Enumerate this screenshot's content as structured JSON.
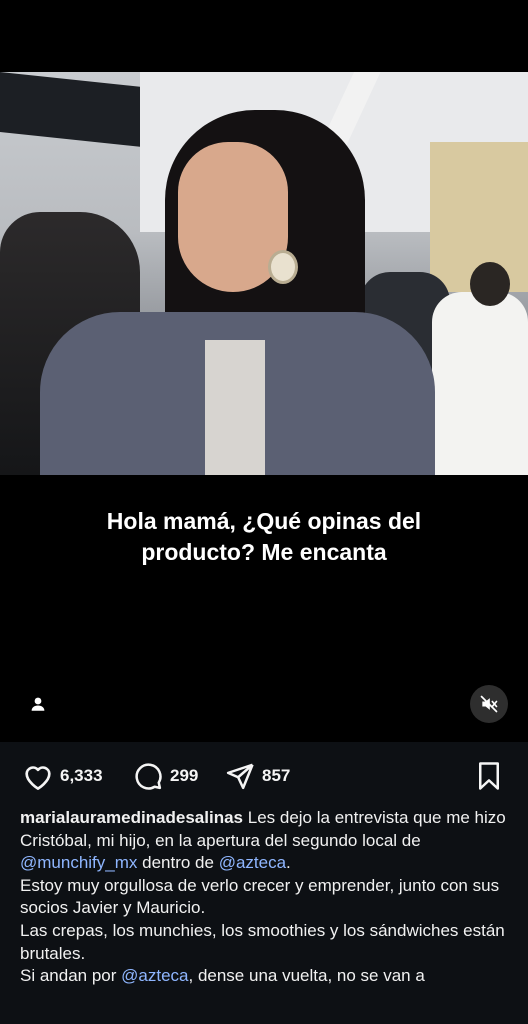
{
  "video": {
    "caption_line1": "Hola mamá, ¿Qué opinas del",
    "caption_line2": "producto? Me encanta"
  },
  "actions": {
    "likes": "6,333",
    "comments": "299",
    "shares": "857"
  },
  "post": {
    "username": "marialauramedinadesalinas",
    "text1": " Les dejo la entrevista que me hizo Cristóbal, mi hijo, en la apertura del segundo local de ",
    "mention1": "@munchify_mx",
    "text2": " dentro de ",
    "mention2": "@azteca",
    "text3": ".",
    "para2": "Estoy muy orgullosa de verlo crecer y emprender, junto con sus socios Javier y Mauricio.",
    "para3": "Las crepas, los munchies, los smoothies y los sándwiches están brutales.",
    "para4_a": "Si andan por ",
    "mention3": "@azteca",
    "para4_b": ", dense una vuelta, no se van a"
  },
  "icons": {
    "like": "heart-icon",
    "comment": "comment-bubble-icon",
    "share": "paper-plane-icon",
    "save": "bookmark-icon",
    "user_tag": "person-icon",
    "mute": "speaker-muted-icon"
  },
  "colors": {
    "background": "#000000",
    "post_background": "#0d1014",
    "mention": "#8fb6ff"
  }
}
